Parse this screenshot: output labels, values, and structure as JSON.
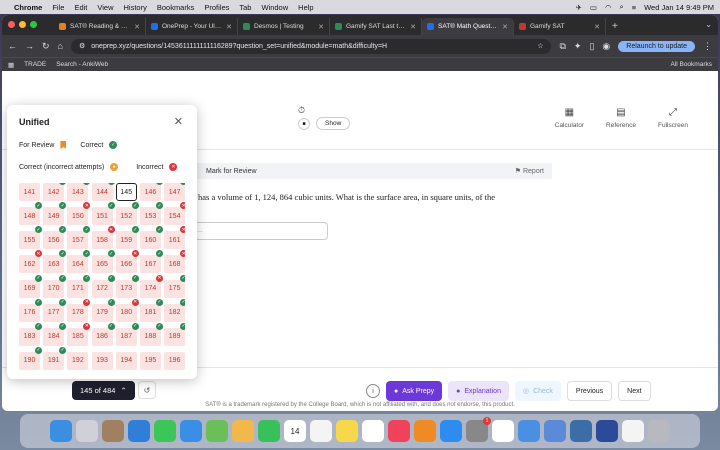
{
  "menubar": {
    "app": "Chrome",
    "items": [
      "File",
      "Edit",
      "View",
      "History",
      "Bookmarks",
      "Profiles",
      "Tab",
      "Window",
      "Help"
    ],
    "datetime": "Wed Jan 14  9:49 PM"
  },
  "tabs": [
    {
      "title": "SAT® Reading & Writing",
      "color": "#e67e22"
    },
    {
      "title": "OnePrep - Your Ultimate",
      "color": "#1f6feb"
    },
    {
      "title": "Desmos | Testing",
      "color": "#2e8b57"
    },
    {
      "title": "Gamify SAT Last to Stop",
      "color": "#2e8b57"
    },
    {
      "title": "SAT® Math Question ba",
      "color": "#1f6feb",
      "active": true
    },
    {
      "title": "Gamify SAT",
      "color": "#c0392b"
    }
  ],
  "toolbar": {
    "url": "oneprep.xyz/questions/1453611111111116289?question_set=unified&module=math&difficulty=H",
    "relaunch": "Relaunch to update"
  },
  "bookmarks": {
    "items": [
      "TRADE",
      "Search - AnkiWeb"
    ],
    "all": "All Bookmarks"
  },
  "page": {
    "show_label": "Show",
    "tools": [
      {
        "label": "Calculator",
        "icon": "calculator-icon"
      },
      {
        "label": "Reference",
        "icon": "reference-icon"
      },
      {
        "label": "Fullscreen",
        "icon": "fullscreen-icon"
      }
    ],
    "mark_for_review": "Mark for Review",
    "report": "Report",
    "question_fragment": "has a volume of 1, 124, 864 cubic units. What is the surface area, in square units, of the",
    "answer_placeholder": "..."
  },
  "popover": {
    "title": "Unified",
    "legend_review": "For Review",
    "legend_correct": "Correct",
    "legend_correct_incorrect": "Correct (incorrect attempts)",
    "legend_incorrect": "Incorrect",
    "current": 145,
    "cells": [
      {
        "n": 141,
        "s": ""
      },
      {
        "n": 142,
        "s": "c"
      },
      {
        "n": 143,
        "s": "c"
      },
      {
        "n": 144,
        "s": "c"
      },
      {
        "n": 145,
        "s": "cur"
      },
      {
        "n": 146,
        "s": "c"
      },
      {
        "n": 147,
        "s": "c"
      },
      {
        "n": 148,
        "s": "c"
      },
      {
        "n": 149,
        "s": "c"
      },
      {
        "n": 150,
        "s": "i"
      },
      {
        "n": 151,
        "s": "c"
      },
      {
        "n": 152,
        "s": "c"
      },
      {
        "n": 153,
        "s": "c"
      },
      {
        "n": 154,
        "s": "i"
      },
      {
        "n": 155,
        "s": "c"
      },
      {
        "n": 156,
        "s": "c"
      },
      {
        "n": 157,
        "s": "c"
      },
      {
        "n": 158,
        "s": "i"
      },
      {
        "n": 159,
        "s": "c"
      },
      {
        "n": 160,
        "s": "c"
      },
      {
        "n": 161,
        "s": "i"
      },
      {
        "n": 162,
        "s": "i"
      },
      {
        "n": 163,
        "s": "c"
      },
      {
        "n": 164,
        "s": "c"
      },
      {
        "n": 165,
        "s": "c"
      },
      {
        "n": 166,
        "s": "i"
      },
      {
        "n": 167,
        "s": "c"
      },
      {
        "n": 168,
        "s": "i"
      },
      {
        "n": 169,
        "s": "c"
      },
      {
        "n": 170,
        "s": "c"
      },
      {
        "n": 171,
        "s": "c"
      },
      {
        "n": 172,
        "s": "c"
      },
      {
        "n": 173,
        "s": "c"
      },
      {
        "n": 174,
        "s": "i"
      },
      {
        "n": 175,
        "s": "c"
      },
      {
        "n": 176,
        "s": "c"
      },
      {
        "n": 177,
        "s": "c"
      },
      {
        "n": 178,
        "s": "i"
      },
      {
        "n": 179,
        "s": "c"
      },
      {
        "n": 180,
        "s": "i"
      },
      {
        "n": 181,
        "s": "c"
      },
      {
        "n": 182,
        "s": "c"
      },
      {
        "n": 183,
        "s": "c"
      },
      {
        "n": 184,
        "s": "c"
      },
      {
        "n": 185,
        "s": "i"
      },
      {
        "n": 186,
        "s": "c"
      },
      {
        "n": 187,
        "s": "c"
      },
      {
        "n": 188,
        "s": "c"
      },
      {
        "n": 189,
        "s": "c"
      },
      {
        "n": 190,
        "s": "c"
      },
      {
        "n": 191,
        "s": "c"
      },
      {
        "n": 192,
        "s": ""
      },
      {
        "n": 193,
        "s": ""
      },
      {
        "n": 194,
        "s": ""
      },
      {
        "n": 195,
        "s": ""
      },
      {
        "n": 196,
        "s": ""
      }
    ]
  },
  "bottom": {
    "counter": "145 of 484",
    "ask_prepy": "Ask Prepy",
    "explanation": "Explanation",
    "check": "Check",
    "previous": "Previous",
    "next": "Next",
    "footer": "SAT® is a trademark registered by the College Board, which is not affiliated with, and does not endorse, this product."
  },
  "dock": {
    "icons": [
      {
        "name": "finder-icon",
        "color": "#3b8fe0"
      },
      {
        "name": "launchpad-icon",
        "color": "#d0d0d8"
      },
      {
        "name": "notes-app-icon",
        "color": "#a08060"
      },
      {
        "name": "safari-icon",
        "color": "#2f7fd8"
      },
      {
        "name": "messages-icon",
        "color": "#3cc65a"
      },
      {
        "name": "mail-icon",
        "color": "#3a8ee6"
      },
      {
        "name": "maps-icon",
        "color": "#6bbf59"
      },
      {
        "name": "photos-icon",
        "color": "#f2b84b"
      },
      {
        "name": "facetime-icon",
        "color": "#38c05a"
      },
      {
        "name": "calendar-icon",
        "color": "#ffffff"
      },
      {
        "name": "reminders-icon",
        "color": "#f4f4f4"
      },
      {
        "name": "notes-icon",
        "color": "#f7d84a"
      },
      {
        "name": "freeform-icon",
        "color": "#ffffff"
      },
      {
        "name": "music-icon",
        "color": "#f0425a"
      },
      {
        "name": "books-icon",
        "color": "#f08a24"
      },
      {
        "name": "app-store-icon",
        "color": "#2d8cf0"
      },
      {
        "name": "settings-icon",
        "color": "#888888"
      },
      {
        "name": "chrome-icon",
        "color": "#ffffff"
      },
      {
        "name": "xcode-icon",
        "color": "#4a90e2"
      },
      {
        "name": "preview-icon",
        "color": "#5a8ad8"
      },
      {
        "name": "finder-window-icon",
        "color": "#3b6ea8"
      },
      {
        "name": "send-icon",
        "color": "#2b4a9a"
      },
      {
        "name": "document-icon",
        "color": "#f4f4f4"
      },
      {
        "name": "trash-icon",
        "color": "#b8b8c0"
      }
    ],
    "calendar_day": "14",
    "badge": "1"
  }
}
